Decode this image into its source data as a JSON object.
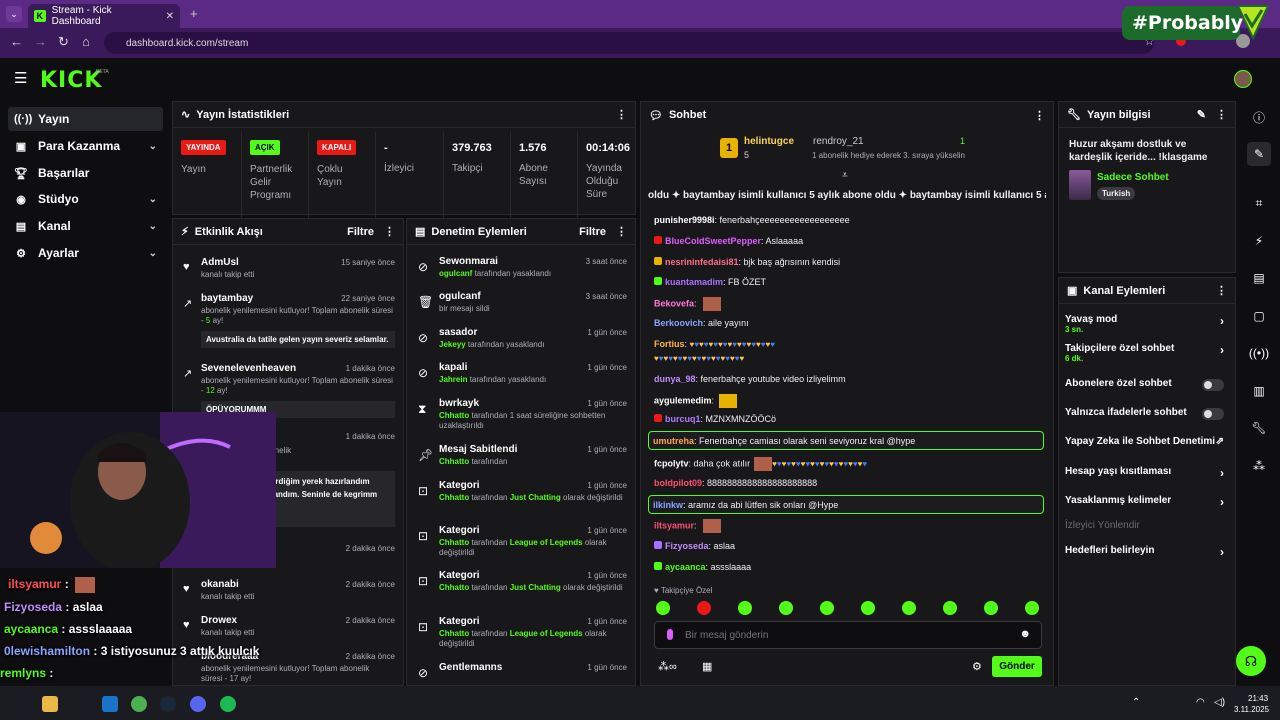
{
  "browser": {
    "tab_title": "Stream - Kick Dashboard",
    "url": "dashboard.kick.com/stream",
    "new_tab": "+"
  },
  "overlay_brand": "#Probably",
  "app": {
    "logo": "KICK",
    "beta": "BETA"
  },
  "nav": [
    {
      "label": "Yayın"
    },
    {
      "label": "Para Kazanma"
    },
    {
      "label": "Başarılar"
    },
    {
      "label": "Stüdyo"
    },
    {
      "label": "Kanal"
    },
    {
      "label": "Ayarlar"
    }
  ],
  "stats": {
    "title": "Yayın İstatistikleri",
    "status_badge": "YAYINDA",
    "status_label": "Yayın",
    "partner_badge": "AÇIK",
    "partner_label": "Partnerlik Gelir Programı",
    "multi_badge": "KAPALI",
    "multi_label": "Çoklu Yayın",
    "viewers_value": "-",
    "viewers_label": "İzleyici",
    "followers_value": "379.763",
    "followers_label": "Takipçi",
    "subs_value": "1.576",
    "subs_label": "Abone Sayısı",
    "uptime_value": "00:14:06",
    "uptime_label": "Yayında Olduğu Süre"
  },
  "activity": {
    "title": "Etkinlik Akışı",
    "filter": "Filtre",
    "items": [
      {
        "name": "AdmUsl",
        "time": "15 saniye önce",
        "sub": "kanalı takip etti"
      },
      {
        "name": "baytambay",
        "time": "22 saniye önce",
        "sub_a": "abonelik yenilemesini kutluyor! Toplam abonelik süresi - ",
        "sub_n": "5",
        "sub_b": " ay!",
        "msg": "Avustralia da tatile gelen yayın severiz selamlar."
      },
      {
        "name": "Sevenelevenheaven",
        "time": "1 dakika önce",
        "sub_a": "abonelik yenilemesini kutluyor! Toplam abonelik süresi - ",
        "sub_n": "12",
        "sub_b": " ay!",
        "msg": "ÖPÜYORUMMM"
      },
      {
        "time": "1 dakika önce",
        "sub": "kutluyor! Toplam abonelik"
      },
      {
        "msg": "kaz buluyorum. Girdiğim yerek hazırlandım şimdi de olarak atandım. Seninle de kegrimm"
      },
      {
        "time": "2 dakika önce"
      },
      {
        "name": "okanabi",
        "time": "2 dakika önce",
        "sub": "kanalı takip etti"
      },
      {
        "name": "Drowex",
        "time": "2 dakika önce",
        "sub": "kanalı takip etti"
      },
      {
        "name": "bloodreraaa",
        "time": "2 dakika önce",
        "sub": "abonelik yenilemesini kutluyor! Toplam abonelik",
        "sub2": "süresi - 17 ay!"
      }
    ]
  },
  "moderation": {
    "title": "Denetim Eylemleri",
    "filter": "Filtre",
    "items": [
      {
        "name": "Sewonmarai",
        "time": "3 saat önce",
        "by": "ogulcanf",
        "rest": " tarafından yasaklandı"
      },
      {
        "name": "ogulcanf",
        "time": "3 saat önce",
        "plain": "bir mesajı sildi"
      },
      {
        "name": "sasador",
        "time": "1 gün önce",
        "by": "Jekeyy",
        "rest": " tarafından yasaklandı"
      },
      {
        "name": "kapali",
        "time": "1 gün önce",
        "by": "Jahrein",
        "rest": " tarafından yasaklandı"
      },
      {
        "name": "bwrkayk",
        "time": "1 gün önce",
        "by": "Chhatto",
        "rest": " tarafından 1 saat süreliğine sohbetten uzaklaştırıldı"
      },
      {
        "name": "Mesaj Sabitlendi",
        "time": "1 gün önce",
        "by": "Chhatto",
        "rest": " tarafından"
      },
      {
        "name": "Kategori",
        "time": "1 gün önce",
        "by": "Chhatto",
        "rest": " tarafından ",
        "cat": "Just Chatting",
        "rest2": " olarak değiştirildi"
      },
      {
        "name": "Kategori",
        "time": "1 gün önce",
        "by": "Chhatto",
        "rest": " tarafından ",
        "cat": "League of Legends",
        "rest2": " olarak değiştirildi"
      },
      {
        "name": "Kategori",
        "time": "1 gün önce",
        "by": "Chhatto",
        "rest": " tarafından ",
        "cat": "Just Chatting",
        "rest2": " olarak değiştirildi"
      },
      {
        "name": "Kategori",
        "time": "1 gün önce",
        "by": "Chhatto",
        "rest": " tarafından ",
        "cat": "League of Legends",
        "rest2": " olarak değiştirildi"
      },
      {
        "name": "Gentlemanns",
        "time": "1 gün önce"
      }
    ]
  },
  "chat": {
    "title": "Sohbet",
    "leader_name": "helintugce",
    "leader_count": "5",
    "leader2": "rendroy_21",
    "leader2_count": "1",
    "leader2_sub": "1 abonelik hediye ederek 3. sıraya yükselin",
    "ticker": "oldu  ✦ baytambay isimli kullanıcı 5 aylık abone oldu  ✦ baytambay isimli kullanıcı 5 a",
    "lines": [
      {
        "user": "punisher9998i",
        "color": "#ffffff",
        "text": "fenerbahçeeeeeeeeeeeeeeeeee"
      },
      {
        "user": "BlueColdSweetPepper",
        "color": "#e05cff",
        "text": "Aslaaaaa"
      },
      {
        "user": "nesrininfedaisi81",
        "color": "#ff6e8a",
        "text": "bjk baş ağrısının kendisi"
      },
      {
        "user": "kuantamadim",
        "color": "#a970ff",
        "text": "FB ÖZET"
      },
      {
        "user": "Bekovefa",
        "color": "#ff7ad9",
        "text": ""
      },
      {
        "user": "Berkoovich",
        "color": "#8aa4ff",
        "text": "aile yayını"
      },
      {
        "user": "Fortius",
        "color": "#ffb347",
        "text": ""
      },
      {
        "user": "dunya_98",
        "color": "#c38cff",
        "text": "fenerbahçe youtube video izliyelimm"
      },
      {
        "user": "aygulemedim",
        "color": "#ffffff",
        "text": ""
      },
      {
        "user": "burcuq1",
        "color": "#b27aff",
        "text": "MZNXMNZÖÖCö"
      },
      {
        "user": "umutreha",
        "color": "#ffa64d",
        "text": "Fenerbahçe camiası olarak seni seviyoruz kral @hype"
      },
      {
        "user": "fcpolytv",
        "color": "#ffffff",
        "text": "daha çok atılır"
      },
      {
        "user": "boldpilot09",
        "color": "#ff4d6d",
        "text": "8888888888888888888888"
      },
      {
        "user": "ilkinkw",
        "color": "#8aa4ff",
        "text": "aramız da abi lütfen sik onları @Hype"
      },
      {
        "user": "iltsyamur",
        "color": "#ff4d6d",
        "text": ""
      },
      {
        "user": "Fizyoseda",
        "color": "#c38cff",
        "text": "aslaa"
      },
      {
        "user": "aycaanca",
        "color": "#53fc18",
        "text": "assslaaaa"
      }
    ],
    "follower_only": "Takipçiye Özel",
    "placeholder": "Bir mesaj gönderin",
    "send": "Gönder"
  },
  "stream_info": {
    "title": "Yayın bilgisi",
    "stream_title": "Huzur akşamı dostluk ve kardeşlik içeride... !klasgame",
    "category": "Sadece Sohbet",
    "language": "Turkish"
  },
  "channel_actions": {
    "title": "Kanal Eylemleri",
    "items": [
      {
        "label": "Yavaş mod",
        "sub": "3 sn."
      },
      {
        "label": "Takipçilere özel sohbet",
        "sub": "6 dk."
      },
      {
        "label": "Abonelere özel sohbet"
      },
      {
        "label": "Yalnızca ifadelerle sohbet"
      },
      {
        "label": "Yapay Zeka ile Sohbet Denetimi"
      },
      {
        "label": "Hesap yaşı kısıtlaması"
      },
      {
        "label": "Yasaklanmış kelimeler"
      },
      {
        "label": "İzleyici Yönlendir"
      },
      {
        "label": "Hedefleri belirleyin"
      }
    ]
  },
  "overlay": {
    "l1_user": "iltsyamur",
    "l1_sep": " :",
    "l2_user": "Fizyoseda",
    "l2_text": " : aslaa",
    "l3_user": "aycaanca",
    "l3_text": " : assslaaaaa",
    "l4_user": "0lewishamilton",
    "l4_text": " : 3 istiyosunuz 3 attık kuulcık",
    "l5_user": "remlyns",
    "l5_text": " :"
  },
  "taskbar": {
    "time": "21:43",
    "date": "3.11.2025"
  },
  "colors": {
    "accent": "#53fc18",
    "live": "#e91916",
    "panel": "#18181b",
    "chrome": "#5a2a85"
  }
}
